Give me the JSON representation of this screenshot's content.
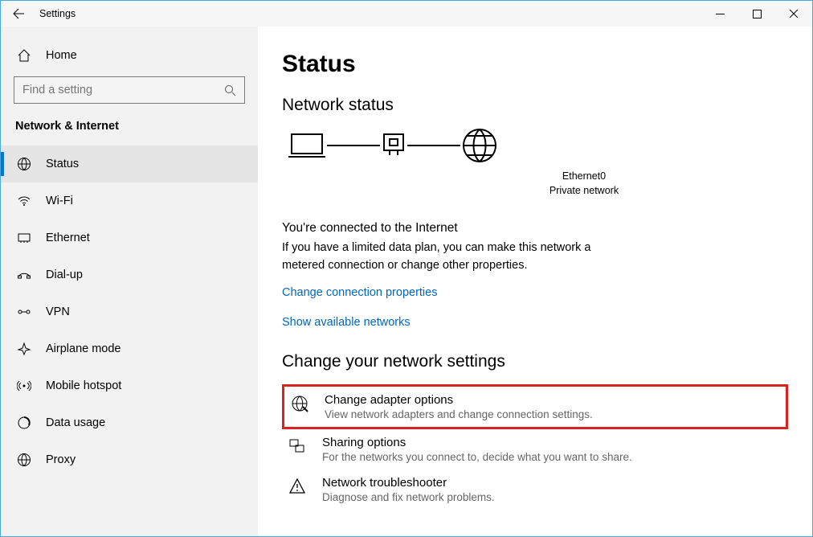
{
  "window": {
    "title": "Settings"
  },
  "sidebar": {
    "home": "Home",
    "search_placeholder": "Find a setting",
    "section": "Network & Internet",
    "items": [
      {
        "label": "Status"
      },
      {
        "label": "Wi-Fi"
      },
      {
        "label": "Ethernet"
      },
      {
        "label": "Dial-up"
      },
      {
        "label": "VPN"
      },
      {
        "label": "Airplane mode"
      },
      {
        "label": "Mobile hotspot"
      },
      {
        "label": "Data usage"
      },
      {
        "label": "Proxy"
      }
    ]
  },
  "main": {
    "heading": "Status",
    "status_heading": "Network status",
    "adapter_name": "Ethernet0",
    "adapter_type": "Private network",
    "connected_title": "You're connected to the Internet",
    "connected_body": "If you have a limited data plan, you can make this network a metered connection or change other properties.",
    "link_change_props": "Change connection properties",
    "link_show_networks": "Show available networks",
    "change_heading": "Change your network settings",
    "settings": [
      {
        "title": "Change adapter options",
        "desc": "View network adapters and change connection settings."
      },
      {
        "title": "Sharing options",
        "desc": "For the networks you connect to, decide what you want to share."
      },
      {
        "title": "Network troubleshooter",
        "desc": "Diagnose and fix network problems."
      }
    ]
  }
}
